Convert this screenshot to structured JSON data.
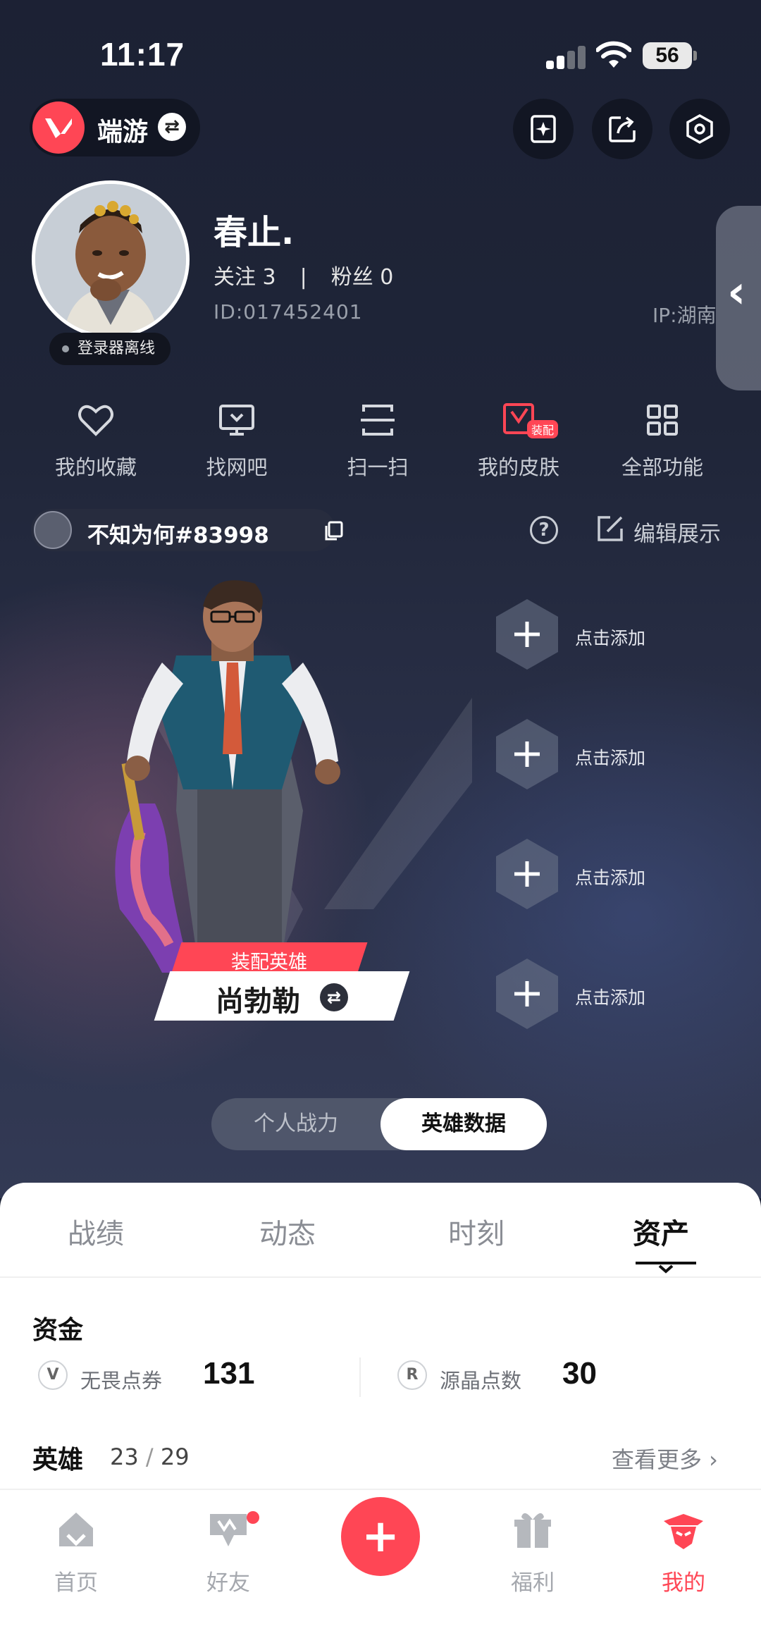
{
  "status_bar": {
    "time": "11:17",
    "battery": "56"
  },
  "header": {
    "app_name": "端游",
    "swap_icon": "swap-icon",
    "buttons": [
      "ai-sparkle-icon",
      "share-icon",
      "settings-hex-icon"
    ]
  },
  "profile": {
    "username": "春止.",
    "follow_label": "关注",
    "follow_count": "3",
    "separator": "|",
    "fans_label": "粉丝",
    "fans_count": "0",
    "id_text": "ID:017452401",
    "ip_text": "IP:湖南",
    "status": "登录器离线"
  },
  "quick_actions": [
    {
      "label": "我的收藏",
      "icon": "heart-icon"
    },
    {
      "label": "找网吧",
      "icon": "monitor-icon"
    },
    {
      "label": "扫一扫",
      "icon": "scan-icon"
    },
    {
      "label": "我的皮肤",
      "icon": "skin-icon",
      "badge": "装配"
    },
    {
      "label": "全部功能",
      "icon": "grid-icon"
    }
  ],
  "game_tag": {
    "name": "不知为何#83998"
  },
  "edit_display": "编辑展示",
  "hero": {
    "equip_label": "装配英雄",
    "name": "尚勃勒"
  },
  "slots": [
    {
      "label": "点击添加"
    },
    {
      "label": "点击添加"
    },
    {
      "label": "点击添加"
    },
    {
      "label": "点击添加"
    }
  ],
  "segment": {
    "options": [
      "个人战力",
      "英雄数据"
    ],
    "selected": "英雄数据"
  },
  "tabs": [
    {
      "label": "战绩"
    },
    {
      "label": "动态"
    },
    {
      "label": "时刻"
    },
    {
      "label": "资产",
      "active": true
    }
  ],
  "assets": {
    "section_title": "资金",
    "currencies": [
      {
        "label": "无畏点券",
        "value": "131",
        "icon": "valorant-points-icon"
      },
      {
        "label": "源晶点数",
        "value": "30",
        "icon": "radianite-icon"
      }
    ],
    "heroes_title": "英雄",
    "heroes_owned": "23",
    "heroes_total": "29",
    "heroes_sep": "/",
    "see_more": "查看更多 ›"
  },
  "bottom_nav": [
    {
      "label": "首页",
      "icon": "home-icon"
    },
    {
      "label": "好友",
      "icon": "friends-icon",
      "dot": true
    },
    {
      "label": "+",
      "icon": "plus-icon"
    },
    {
      "label": "福利",
      "icon": "gift-icon"
    },
    {
      "label": "我的",
      "icon": "profile-icon",
      "active": true
    }
  ],
  "colors": {
    "accent": "#ff4655",
    "bg_dark": "#1c2134",
    "sheet": "#ffffff"
  }
}
